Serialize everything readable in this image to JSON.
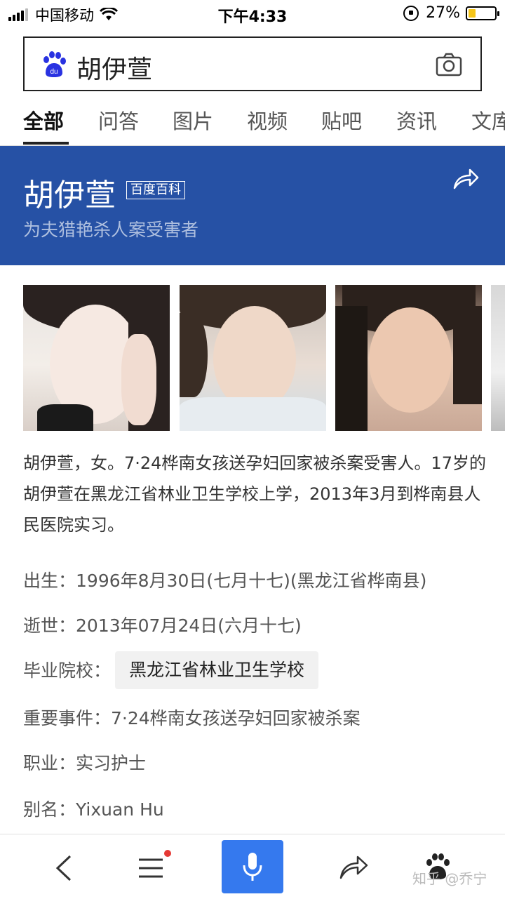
{
  "status_bar": {
    "carrier": "中国移动",
    "time": "下午4:33",
    "battery": "27%",
    "battery_level": 0.27
  },
  "search": {
    "query": "胡伊萱"
  },
  "tabs": [
    {
      "label": "全部"
    },
    {
      "label": "问答"
    },
    {
      "label": "图片"
    },
    {
      "label": "视频"
    },
    {
      "label": "贴吧"
    },
    {
      "label": "资讯"
    },
    {
      "label": "文库"
    }
  ],
  "card": {
    "title": "胡伊萱",
    "badge": "百度百科",
    "subtitle": "为夫猎艳杀人案受害者"
  },
  "description": "胡伊萱，女。7·24桦南女孩送孕妇回家被杀案受害人。17岁的胡伊萱在黑龙江省林业卫生学校上学，2013年3月到桦南县人民医院实习。",
  "info": {
    "birth_label": "出生：",
    "birth_value": "1996年8月30日(七月十七)(黑龙江省桦南县)",
    "death_label": "逝世：",
    "death_value": "2013年07月24日(六月十七)",
    "school_label": "毕业院校：",
    "school_value": "黑龙江省林业卫生学校",
    "event_label": "重要事件：",
    "event_value": "7·24桦南女孩送孕妇回家被杀案",
    "job_label": "职业：",
    "job_value": "实习护士",
    "alias_label": "别名：",
    "alias_value": "Yixuan Hu"
  },
  "watermark": "知乎 @乔宁",
  "colors": {
    "card_blue": "#2651a5",
    "mic_blue": "#3579ee",
    "notification_red": "#e53935"
  },
  "icons": [
    "baidu-paw-icon",
    "camera-icon",
    "share-icon",
    "back-icon",
    "menu-icon",
    "microphone-icon",
    "paw-icon"
  ]
}
